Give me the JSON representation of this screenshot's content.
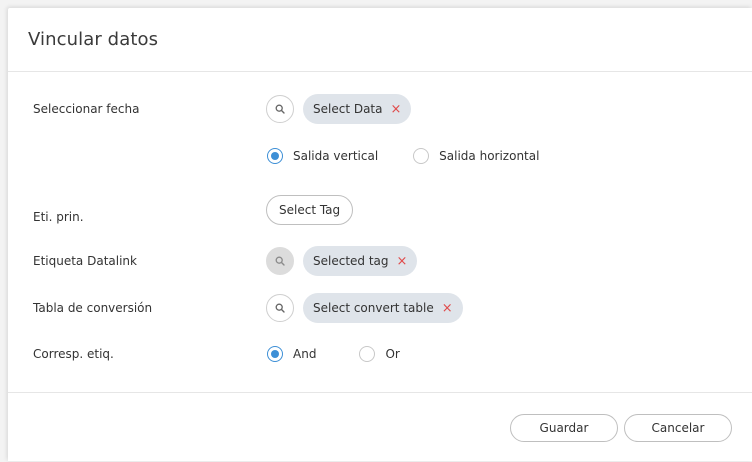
{
  "dialog": {
    "title": "Vincular datos",
    "fields": {
      "date": {
        "label": "Seleccionar fecha",
        "chip": "Select Data",
        "chip_remove": "×",
        "search_icon": "search-icon"
      },
      "output": {
        "options": [
          {
            "label": "Salida vertical",
            "selected": true
          },
          {
            "label": "Salida horizontal",
            "selected": false
          }
        ]
      },
      "main_tag": {
        "label": "Eti. prin.",
        "button": "Select Tag"
      },
      "datalink_tag": {
        "label": "Etiqueta Datalink",
        "chip": "Selected tag",
        "chip_remove": "×",
        "search_icon": "search-icon"
      },
      "convert_table": {
        "label": "Tabla de conversión",
        "chip": "Select convert table",
        "chip_remove": "×",
        "search_icon": "search-icon"
      },
      "tag_match": {
        "label": "Corresp. etiq.",
        "options": [
          {
            "label": "And",
            "selected": true
          },
          {
            "label": "Or",
            "selected": false
          }
        ]
      }
    },
    "footer": {
      "save": "Guardar",
      "cancel": "Cancelar"
    }
  },
  "colors": {
    "accent": "#3d8fd6",
    "chip_bg": "#dfe4ea",
    "remove_x": "#e04a4a"
  }
}
